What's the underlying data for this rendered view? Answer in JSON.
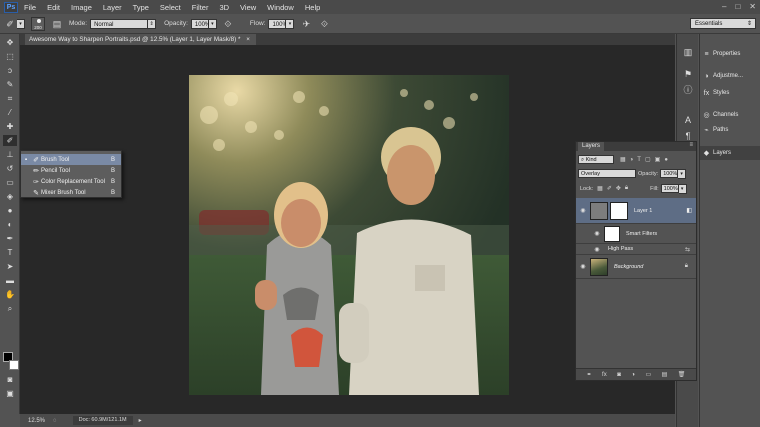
{
  "menu": {
    "logo": "Ps",
    "items": [
      "File",
      "Edit",
      "Image",
      "Layer",
      "Type",
      "Select",
      "Filter",
      "3D",
      "View",
      "Window",
      "Help"
    ],
    "window_controls": [
      "–",
      "□",
      "✕"
    ]
  },
  "options": {
    "brush_size": "200",
    "mode_label": "Mode:",
    "mode_value": "Normal",
    "opacity_label": "Opacity:",
    "opacity_value": "100%",
    "flow_label": "Flow:",
    "flow_value": "100%",
    "workspace": "Essentials"
  },
  "document": {
    "tab_title": "Awesome Way to Sharpen Portraits.psd @ 12.5% (Layer 1, Layer Mask/8) *",
    "close": "×"
  },
  "tools": [
    {
      "name": "move-tool-icon",
      "glyph": "✥"
    },
    {
      "name": "marquee-tool-icon",
      "glyph": "⬚"
    },
    {
      "name": "lasso-tool-icon",
      "glyph": "ↄ"
    },
    {
      "name": "quick-select-tool-icon",
      "glyph": "✎"
    },
    {
      "name": "crop-tool-icon",
      "glyph": "⌗"
    },
    {
      "name": "eyedropper-tool-icon",
      "glyph": "⁄"
    },
    {
      "name": "healing-tool-icon",
      "glyph": "✚"
    },
    {
      "name": "brush-tool-icon",
      "glyph": "✐",
      "active": true
    },
    {
      "name": "clone-stamp-tool-icon",
      "glyph": "⊥"
    },
    {
      "name": "history-brush-tool-icon",
      "glyph": "↺"
    },
    {
      "name": "eraser-tool-icon",
      "glyph": "▭"
    },
    {
      "name": "paint-bucket-tool-icon",
      "glyph": "◈"
    },
    {
      "name": "blur-tool-icon",
      "glyph": "●"
    },
    {
      "name": "dodge-tool-icon",
      "glyph": "◐"
    },
    {
      "name": "pen-tool-icon",
      "glyph": "✒"
    },
    {
      "name": "type-tool-icon",
      "glyph": "T"
    },
    {
      "name": "path-select-tool-icon",
      "glyph": "➤"
    },
    {
      "name": "shape-tool-icon",
      "glyph": "▬"
    },
    {
      "name": "hand-tool-icon",
      "glyph": "✋"
    },
    {
      "name": "zoom-tool-icon",
      "glyph": "⌕"
    }
  ],
  "flyout": {
    "items": [
      {
        "label": "Brush Tool",
        "key": "B",
        "glyph": "✐",
        "selected": true
      },
      {
        "label": "Pencil Tool",
        "key": "B",
        "glyph": "✏"
      },
      {
        "label": "Color Replacement Tool",
        "key": "B",
        "glyph": "✑"
      },
      {
        "label": "Mixer Brush Tool",
        "key": "B",
        "glyph": "✎"
      }
    ]
  },
  "status": {
    "zoom": "12.5%",
    "doc_info": "Doc: 60.9M/121.1M"
  },
  "dock_panels": [
    {
      "label": "Properties",
      "glyph": "≡"
    },
    {
      "label": "Adjustme...",
      "glyph": "◑"
    },
    {
      "label": "Styles",
      "glyph": "fx"
    },
    {
      "label": "Channels",
      "glyph": "◎"
    },
    {
      "label": "Paths",
      "glyph": "⌁"
    },
    {
      "label": "Layers",
      "glyph": "◆",
      "active": true
    }
  ],
  "layers_panel": {
    "tab": "Layers",
    "kind_label": "Kind",
    "blend_mode": "Overlay",
    "opacity_label": "Opacity:",
    "opacity_value": "100%",
    "lock_label": "Lock:",
    "fill_label": "Fill:",
    "fill_value": "100%",
    "layers": [
      {
        "name": "Layer 1",
        "selected": true
      },
      {
        "name": "Smart Filters"
      },
      {
        "name": "High Pass"
      },
      {
        "name": "Background"
      }
    ]
  },
  "colors": {
    "accent_select": "#5e6d85",
    "foreground": "#000000",
    "background": "#ffffff"
  }
}
